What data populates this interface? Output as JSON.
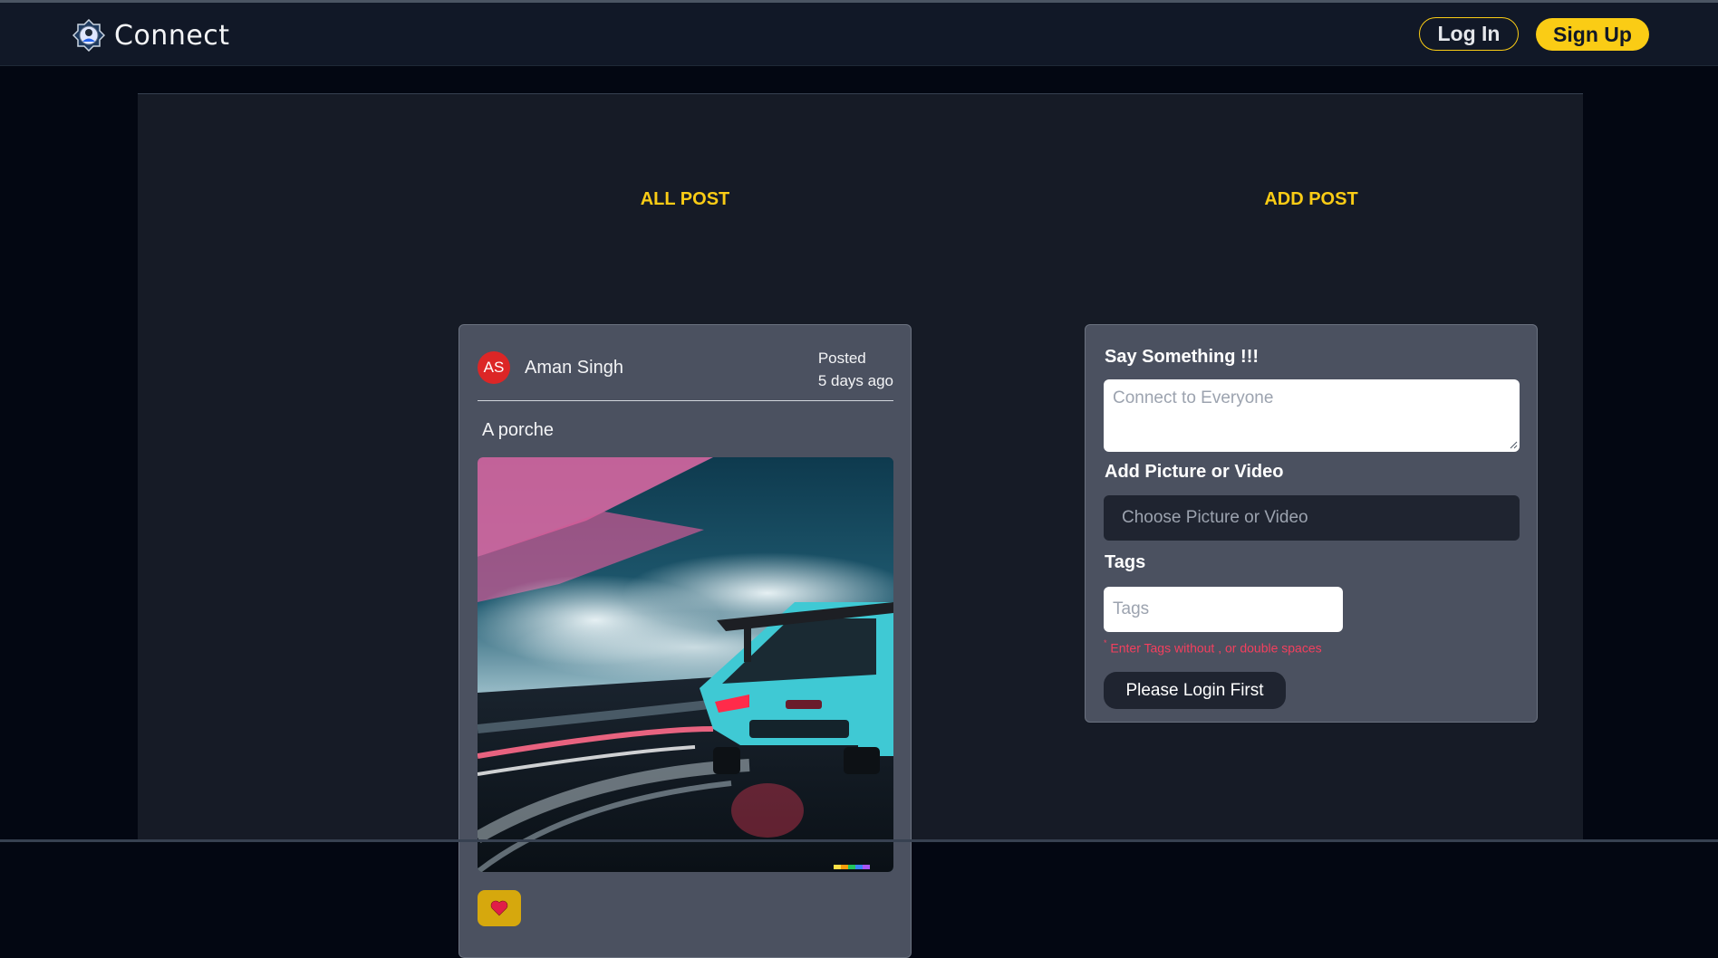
{
  "navbar": {
    "brand_name": "Connect",
    "login_label": "Log In",
    "signup_label": "Sign Up",
    "accent_color": "#facc15"
  },
  "feed": {
    "title": "ALL POST",
    "posts": [
      {
        "author_initials": "AS",
        "author_name": "Aman Singh",
        "posted_label": "Posted",
        "posted_time": "5 days ago",
        "caption": "A porche",
        "image_subject": "teal porsche race car on track at dusk",
        "like_icon": "heart-icon"
      }
    ]
  },
  "add_post": {
    "title": "ADD POST",
    "say_label": "Say Something !!!",
    "say_placeholder": "Connect to Everyone",
    "media_label": "Add Picture or Video",
    "media_placeholder": "Choose Picture or Video",
    "tags_label": "Tags",
    "tags_placeholder": "Tags",
    "tags_hint_mark": "*",
    "tags_hint": "Enter Tags without , or double spaces",
    "submit_label": "Please Login First"
  }
}
